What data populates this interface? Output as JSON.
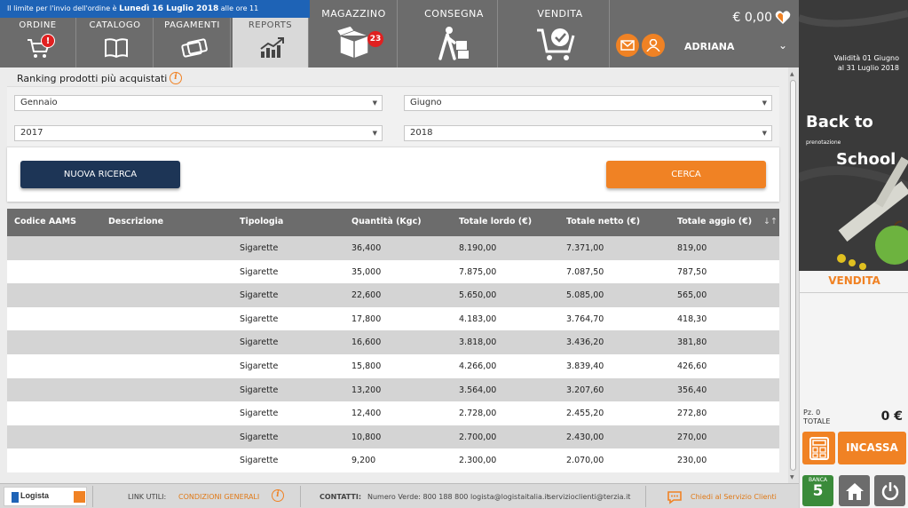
{
  "header": {
    "notice_prefix": "Il limite per l'invio dell'ordine è",
    "notice_date": "Lunedì 16 Luglio 2018",
    "notice_suffix": "alle ore 11",
    "tabs_small": [
      {
        "label": "ORDINE",
        "badge": "!"
      },
      {
        "label": "CATALOGO"
      },
      {
        "label": "PAGAMENTI"
      },
      {
        "label": "REPORTS"
      }
    ],
    "tabs_large": [
      {
        "label": "MAGAZZINO",
        "badge": "23"
      },
      {
        "label": "CONSEGNA"
      },
      {
        "label": "VENDITA"
      }
    ],
    "balance": "€ 0,00",
    "username": "ADRIANA"
  },
  "main": {
    "title": "Ranking prodotti più acquistati",
    "filters": {
      "month_from": "Gennaio",
      "month_to": "Giugno",
      "year_from": "2017",
      "year_to": "2018"
    },
    "buttons": {
      "new_search": "NUOVA RICERCA",
      "search": "CERCA"
    },
    "table": {
      "headers": [
        "Codice AAMS",
        "Descrizione",
        "Tipologia",
        "Quantità (Kgc)",
        "Totale lordo (€)",
        "Totale netto (€)",
        "Totale aggio (€)"
      ],
      "sort_glyph": "↓↑",
      "rows": [
        {
          "tipologia": "Sigarette",
          "quantita": "36,400",
          "lordo": "8.190,00",
          "netto": "7.371,00",
          "aggio": "819,00"
        },
        {
          "tipologia": "Sigarette",
          "quantita": "35,000",
          "lordo": "7.875,00",
          "netto": "7.087,50",
          "aggio": "787,50"
        },
        {
          "tipologia": "Sigarette",
          "quantita": "22,600",
          "lordo": "5.650,00",
          "netto": "5.085,00",
          "aggio": "565,00"
        },
        {
          "tipologia": "Sigarette",
          "quantita": "17,800",
          "lordo": "4.183,00",
          "netto": "3.764,70",
          "aggio": "418,30"
        },
        {
          "tipologia": "Sigarette",
          "quantita": "16,600",
          "lordo": "3.818,00",
          "netto": "3.436,20",
          "aggio": "381,80"
        },
        {
          "tipologia": "Sigarette",
          "quantita": "15,800",
          "lordo": "4.266,00",
          "netto": "3.839,40",
          "aggio": "426,60"
        },
        {
          "tipologia": "Sigarette",
          "quantita": "13,200",
          "lordo": "3.564,00",
          "netto": "3.207,60",
          "aggio": "356,40"
        },
        {
          "tipologia": "Sigarette",
          "quantita": "12,400",
          "lordo": "2.728,00",
          "netto": "2.455,20",
          "aggio": "272,80"
        },
        {
          "tipologia": "Sigarette",
          "quantita": "10,800",
          "lordo": "2.700,00",
          "netto": "2.430,00",
          "aggio": "270,00"
        },
        {
          "tipologia": "Sigarette",
          "quantita": "9,200",
          "lordo": "2.300,00",
          "netto": "2.070,00",
          "aggio": "230,00"
        }
      ]
    }
  },
  "ad": {
    "validity_line1": "Validità 01 Giugno",
    "validity_line2": "al 31 Luglio 2018",
    "title_line1": "Back to",
    "title_small": "prenotazione",
    "title_line2": "School"
  },
  "side": {
    "section_label": "VENDITA",
    "pz_label": "Pz. 0",
    "total_label": "TOTALE",
    "total_value": "0 €",
    "incassa_label": "INCASSA",
    "banca_label": "BANCA",
    "banca_number": "5"
  },
  "footer": {
    "logo_text": "Logista",
    "links_label": "LINK UTILI:",
    "conditions_link": "CONDIZIONI GENERALI",
    "contacts_label": "CONTATTI:",
    "phone": "Numero Verde: 800 188 800",
    "email1": "logista@logistaitalia.it",
    "email2": "servizioclienti@terzia.it",
    "chat_link": "Chiedi al Servizio Clienti"
  },
  "colors": {
    "accent": "#f08224",
    "navy": "#1d3556",
    "header_gray": "#6c6c6c",
    "notice_blue": "#1e63b6"
  },
  "icons": [
    "cart-icon",
    "book-icon",
    "cards-icon",
    "chart-up-icon",
    "box-icon",
    "delivery-person-icon",
    "cart-check-icon",
    "mail-icon",
    "user-icon",
    "calculator-icon",
    "home-icon",
    "power-icon",
    "chat-icon",
    "info-icon"
  ]
}
